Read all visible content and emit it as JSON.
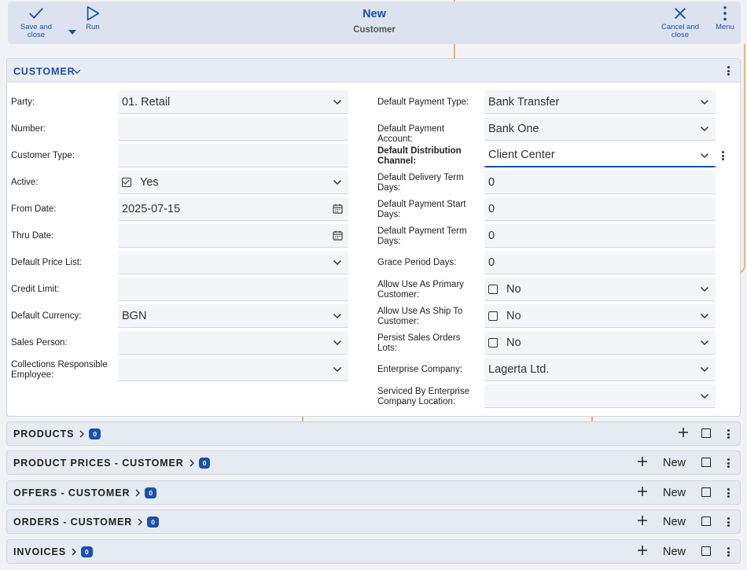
{
  "toolbar": {
    "save_label": "Save and close",
    "run_label": "Run",
    "title": "New",
    "subtitle": "Customer",
    "cancel_label": "Cancel and close",
    "menu_label": "Menu"
  },
  "card": {
    "title": "CUSTOMER"
  },
  "left_fields": [
    {
      "label": "Party:",
      "value": "01. Retail",
      "type": "select"
    },
    {
      "label": "Number:",
      "value": "",
      "type": "text"
    },
    {
      "label": "Customer Type:",
      "value": "",
      "type": "text"
    },
    {
      "label": "Active:",
      "value": "Yes",
      "type": "check-select",
      "checked": true
    },
    {
      "label": "From Date:",
      "value": "2025-07-15",
      "type": "date"
    },
    {
      "label": "Thru Date:",
      "value": "",
      "type": "date"
    },
    {
      "label": "Default Price List:",
      "value": "",
      "type": "select"
    },
    {
      "label": "Credit Limit:",
      "value": "",
      "type": "text"
    },
    {
      "label": "Default Currency:",
      "value": "BGN",
      "type": "select"
    },
    {
      "label": "Sales Person:",
      "value": "",
      "type": "select"
    },
    {
      "label": "Collections Responsible Employee:",
      "value": "",
      "type": "select"
    }
  ],
  "right_fields": [
    {
      "label": "Default Payment Type:",
      "value": "Bank Transfer",
      "type": "select"
    },
    {
      "label": "Default Payment Account:",
      "value": "Bank One",
      "type": "select"
    },
    {
      "label": "Default Distribution Channel:",
      "value": "Client Center",
      "type": "select",
      "bold": true,
      "focused": true
    },
    {
      "label": "Default Delivery Term Days:",
      "value": "0",
      "type": "text"
    },
    {
      "label": "Default Payment Start Days:",
      "value": "0",
      "type": "text"
    },
    {
      "label": "Default Payment Term Days:",
      "value": "0",
      "type": "text"
    },
    {
      "label": "Grace Period Days:",
      "value": "0",
      "type": "text"
    },
    {
      "label": "Allow Use As Primary Customer:",
      "value": "No",
      "type": "check-select",
      "checked": false
    },
    {
      "label": "Allow Use As Ship To Customer:",
      "value": "No",
      "type": "check-select",
      "checked": false
    },
    {
      "label": "Persist Sales Orders Lots:",
      "value": "No",
      "type": "check-select",
      "checked": false
    },
    {
      "label": "Enterprise Company:",
      "value": "Lagerta Ltd.",
      "type": "select"
    },
    {
      "label": "Serviced By Enterprise Company Location:",
      "value": "",
      "type": "select"
    }
  ],
  "sections": [
    {
      "title": "PRODUCTS",
      "count": "0",
      "has_new": false
    },
    {
      "title": "PRODUCT PRICES - CUSTOMER",
      "count": "0",
      "has_new": true
    },
    {
      "title": "OFFERS - CUSTOMER",
      "count": "0",
      "has_new": true
    },
    {
      "title": "ORDERS - CUSTOMER",
      "count": "0",
      "has_new": true
    },
    {
      "title": "INVOICES",
      "count": "0",
      "has_new": true
    }
  ],
  "new_label": "New",
  "colors": {
    "accent": "#1a4fb0",
    "guide": "#f0b560"
  }
}
